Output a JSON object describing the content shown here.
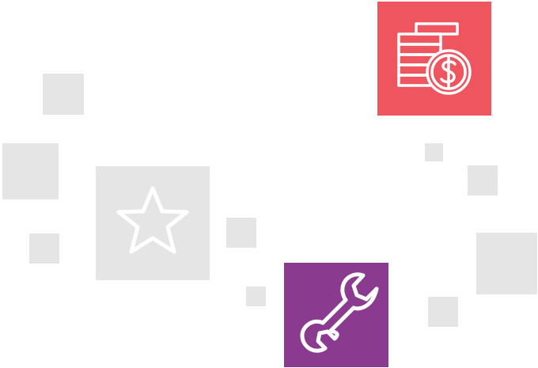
{
  "colors": {
    "decor_square": "#e6e5e6",
    "coins_tile": "#ee555f",
    "wrench_tile": "#8a3a8f",
    "star_tile": "#e6e5e6",
    "icon_stroke": "#ffffff"
  },
  "tiles": [
    {
      "icon": "coins-dollar-icon",
      "color": "#ee555f"
    },
    {
      "icon": "star-icon",
      "color": "#e6e5e6"
    },
    {
      "icon": "wrench-icon",
      "color": "#8a3a8f"
    }
  ]
}
